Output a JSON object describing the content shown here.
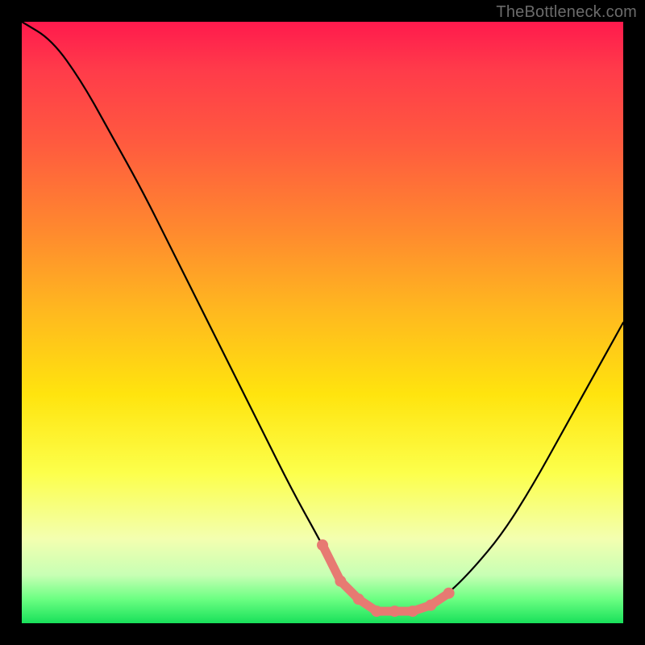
{
  "watermark": "TheBottleneck.com",
  "colors": {
    "background": "#000000",
    "curve": "#000000",
    "marker": "#e77a72",
    "gradient_top": "#ff1a4d",
    "gradient_bottom": "#18e05a"
  },
  "chart_data": {
    "type": "line",
    "title": "",
    "xlabel": "",
    "ylabel": "",
    "xlim": [
      0,
      100
    ],
    "ylim": [
      0,
      100
    ],
    "series": [
      {
        "name": "bottleneck-curve",
        "x": [
          0,
          5,
          10,
          15,
          20,
          25,
          30,
          35,
          40,
          45,
          50,
          53,
          56,
          59,
          62,
          65,
          68,
          71,
          75,
          80,
          85,
          90,
          95,
          100
        ],
        "y": [
          100,
          97,
          90,
          81,
          72,
          62,
          52,
          42,
          32,
          22,
          13,
          7,
          4,
          2,
          2,
          2,
          3,
          5,
          9,
          15,
          23,
          32,
          41,
          50
        ]
      }
    ],
    "highlight_region": {
      "name": "optimal-range",
      "x_start": 50,
      "x_end": 71,
      "points_x": [
        50,
        53,
        56,
        59,
        62,
        65,
        68,
        71
      ],
      "points_y": [
        13,
        7,
        4,
        2,
        2,
        2,
        3,
        5
      ]
    }
  }
}
